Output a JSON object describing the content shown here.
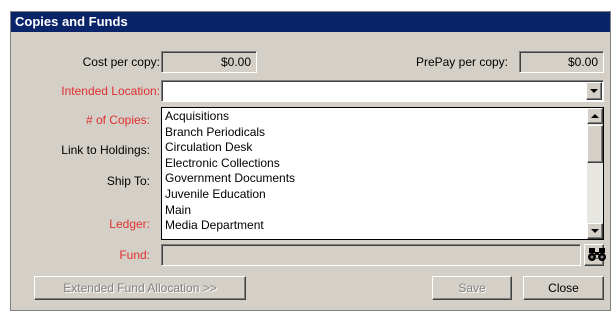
{
  "dialog": {
    "title": "Copies and Funds"
  },
  "fields": {
    "cost_per_copy": {
      "label": "Cost per copy:",
      "value": "$0.00"
    },
    "prepay_per_copy": {
      "label": "PrePay per copy:",
      "value": "$0.00"
    },
    "intended_location": {
      "label": "Intended Location:",
      "value": ""
    },
    "num_copies": {
      "label": "# of Copies:"
    },
    "link_to_holdings": {
      "label": "Link to Holdings:"
    },
    "ship_to": {
      "label": "Ship To:"
    },
    "ledger": {
      "label": "Ledger:"
    },
    "fund": {
      "label": "Fund:",
      "value": "",
      "browse_label": "..."
    }
  },
  "dropdown": {
    "options": [
      "Acquisitions",
      "Branch Periodicals",
      "Circulation Desk",
      "Electronic Collections",
      "Government Documents",
      "Juvenile Education",
      "Main",
      "Media Department"
    ]
  },
  "buttons": {
    "extended_fund_allocation": "Extended Fund Allocation >>",
    "save": "Save",
    "close": "Close"
  },
  "colors": {
    "title_bar": "#0a246a",
    "required_label": "#e03030",
    "dialog_bg": "#d4d0c8"
  }
}
